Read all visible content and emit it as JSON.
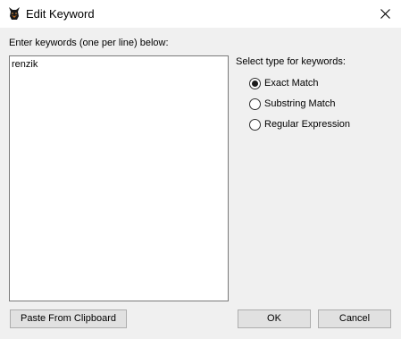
{
  "window": {
    "title": "Edit Keyword",
    "app_icon": "doberman-icon",
    "close_icon": "close-icon"
  },
  "keywords": {
    "label": "Enter keywords (one per line) below:",
    "value": "renzik"
  },
  "match_type": {
    "label": "Select type for keywords:",
    "options": [
      {
        "label": "Exact Match",
        "selected": true
      },
      {
        "label": "Substring Match",
        "selected": false
      },
      {
        "label": "Regular Expression",
        "selected": false
      }
    ]
  },
  "buttons": {
    "paste": "Paste From Clipboard",
    "ok": "OK",
    "cancel": "Cancel"
  }
}
